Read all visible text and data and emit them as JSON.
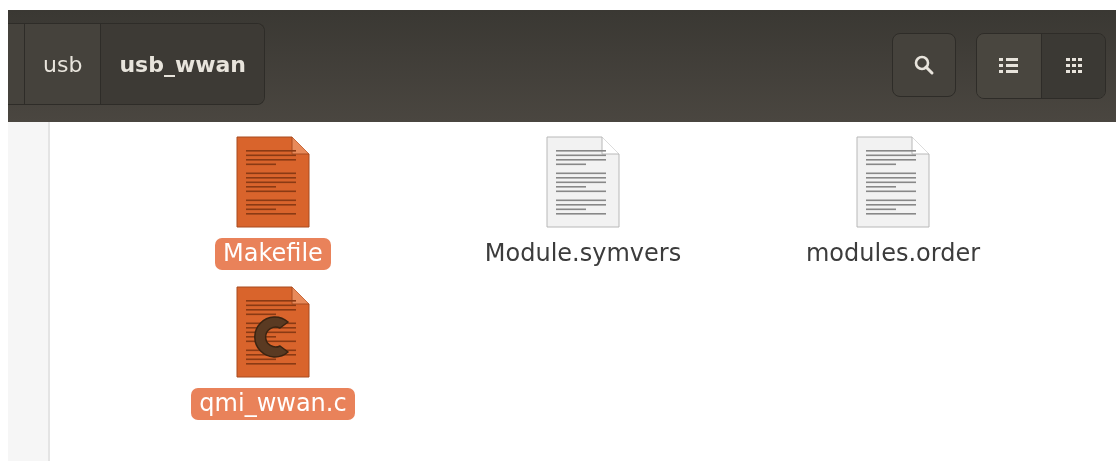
{
  "breadcrumb": [
    {
      "label": "usb",
      "selected": false
    },
    {
      "label": "usb_wwan",
      "selected": true
    }
  ],
  "view_modes": [
    {
      "kind": "list",
      "selected": false
    },
    {
      "kind": "grid",
      "selected": true
    }
  ],
  "files": [
    {
      "name": "Makefile",
      "kind": "text",
      "selected": true
    },
    {
      "name": "Module.symvers",
      "kind": "text",
      "selected": false
    },
    {
      "name": "modules.order",
      "kind": "text",
      "selected": false
    },
    {
      "name": "qmi_wwan.c",
      "kind": "c-source",
      "selected": true
    }
  ]
}
